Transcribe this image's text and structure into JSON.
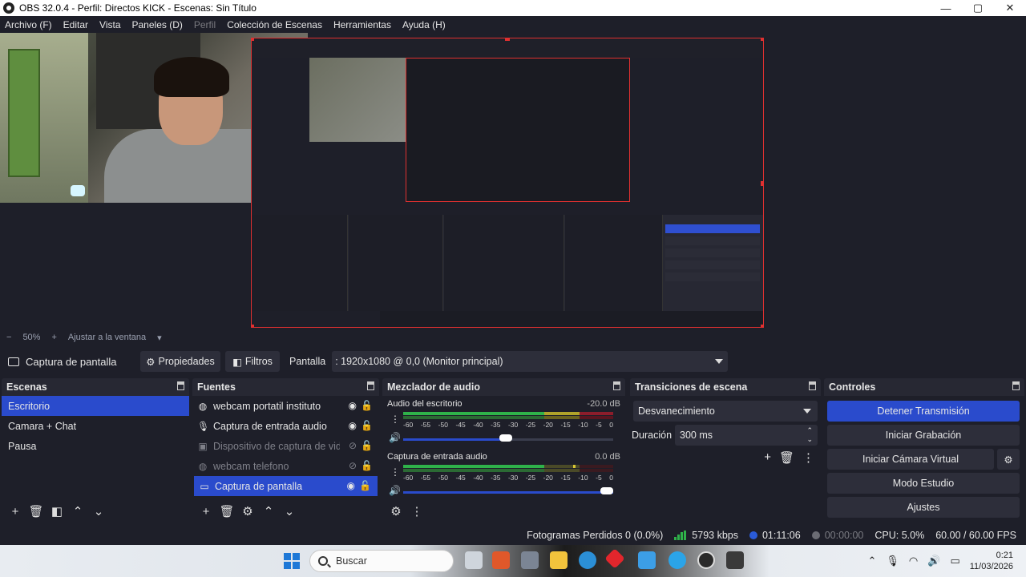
{
  "window": {
    "title": "OBS 32.0.4 - Perfil: Directos KICK - Escenas: Sin Título",
    "minimize": "—",
    "maximize": "▢",
    "close": "✕"
  },
  "menu": {
    "items": [
      "Archivo (F)",
      "Editar",
      "Vista",
      "Paneles (D)",
      "Perfil",
      "Colección de Escenas",
      "Herramientas",
      "Ayuda (H)"
    ],
    "disabled": [
      "Perfil"
    ]
  },
  "zoom": {
    "minus": "−",
    "level": "50%",
    "plus": "+",
    "fit": "Ajustar a la ventana"
  },
  "source_toolbar": {
    "source_name": "Captura de pantalla",
    "properties": "Propiedades",
    "filters": "Filtros",
    "display_label": "Pantalla",
    "display_value": ": 1920x1080 @ 0,0 (Monitor principal)"
  },
  "scenes": {
    "title": "Escenas",
    "items": [
      "Escritorio",
      "Camara + Chat",
      "Pausa"
    ],
    "selected_index": 0
  },
  "sources": {
    "title": "Fuentes",
    "items": [
      {
        "label": "webcam portatil instituto",
        "icon": "globe-icon",
        "visible": true,
        "dim": false
      },
      {
        "label": "Captura de entrada audio",
        "icon": "mic-icon",
        "visible": true,
        "dim": false
      },
      {
        "label": "Dispositivo de captura de video",
        "icon": "camera-icon",
        "visible": false,
        "dim": true
      },
      {
        "label": "webcam telefono",
        "icon": "globe-icon",
        "visible": false,
        "dim": true
      },
      {
        "label": "Captura de pantalla",
        "icon": "monitor-icon",
        "visible": true,
        "dim": false
      }
    ],
    "selected_index": 4
  },
  "mixer": {
    "title": "Mezclador de audio",
    "scale": [
      "-60",
      "-55",
      "-50",
      "-45",
      "-40",
      "-35",
      "-30",
      "-25",
      "-20",
      "-15",
      "-10",
      "-5",
      "0"
    ],
    "channels": [
      {
        "name": "Audio del escritorio",
        "db": "-20.0 dB",
        "volume": 0.49
      },
      {
        "name": "Captura de entrada audio",
        "db": "0.0 dB",
        "volume": 1.0
      }
    ]
  },
  "transitions": {
    "title": "Transiciones de escena",
    "selected": "Desvanecimiento",
    "duration_label": "Duración",
    "duration_value": "300 ms"
  },
  "controls": {
    "title": "Controles",
    "stop_stream": "Detener Transmisión",
    "start_recording": "Iniciar Grabación",
    "start_virtual_cam": "Iniciar Cámara Virtual",
    "studio_mode": "Modo Estudio",
    "settings": "Ajustes"
  },
  "status": {
    "dropped_frames": "Fotogramas Perdidos 0 (0.0%)",
    "bitrate": "5793 kbps",
    "stream_time": "01:11:06",
    "record_time": "00:00:00",
    "cpu": "CPU: 5.0%",
    "fps": "60.00 / 60.00 FPS"
  },
  "taskbar": {
    "search_placeholder": "Buscar",
    "time": "0:21",
    "date": "11/03/2026"
  },
  "colors": {
    "accent": "#2a4bcc",
    "background": "#1e1f29",
    "panel": "#272833",
    "selection_border": "#e03030",
    "meter_green": "#2fb24a",
    "meter_yellow": "#b0a32a",
    "meter_red": "#8c1d2b"
  }
}
